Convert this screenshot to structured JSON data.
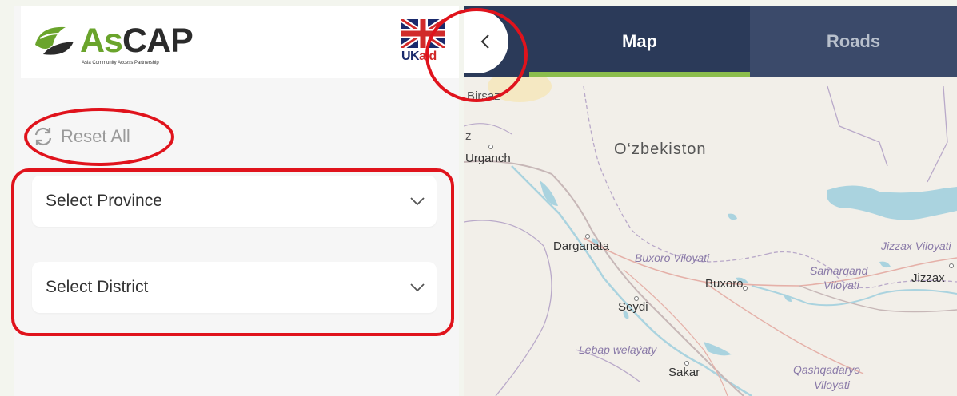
{
  "header": {
    "logo": {
      "brand_as": "As",
      "brand_cap": "CAP",
      "tagline": "Asia Community Access Partnership"
    },
    "ukaid": {
      "uk": "UK",
      "aid": "aid"
    }
  },
  "filters": {
    "reset_label": "Reset All",
    "province_placeholder": "Select Province",
    "district_placeholder": "Select District"
  },
  "tabs": [
    {
      "label": "Map",
      "active": true
    },
    {
      "label": "Roads",
      "active": false
    }
  ],
  "map": {
    "labels": {
      "country": "O‘zbekiston",
      "top_edge": "Birsaz",
      "urganch_prefix": "z",
      "urganch": "Urganch",
      "darganata": "Darganata",
      "buxoro_viloyati": "Buxoro Viloyati",
      "buxoro": "Buxoro",
      "samarqand_viloyati_1": "Samarqand",
      "samarqand_viloyati_2": "Viloyati",
      "jizzax_viloyati": "Jizzax Viloyati",
      "jizzax": "Jizzax",
      "seydi": "Seydi",
      "lebap": "Lebap welaýaty",
      "sakar": "Sakar",
      "qashqadaryo_1": "Qashqadaryo",
      "qashqadaryo_2": "Viloyati"
    }
  },
  "colors": {
    "accent_green": "#8cbd4c",
    "navbar": "#2b3a59",
    "annotation_red": "#e0131c"
  }
}
